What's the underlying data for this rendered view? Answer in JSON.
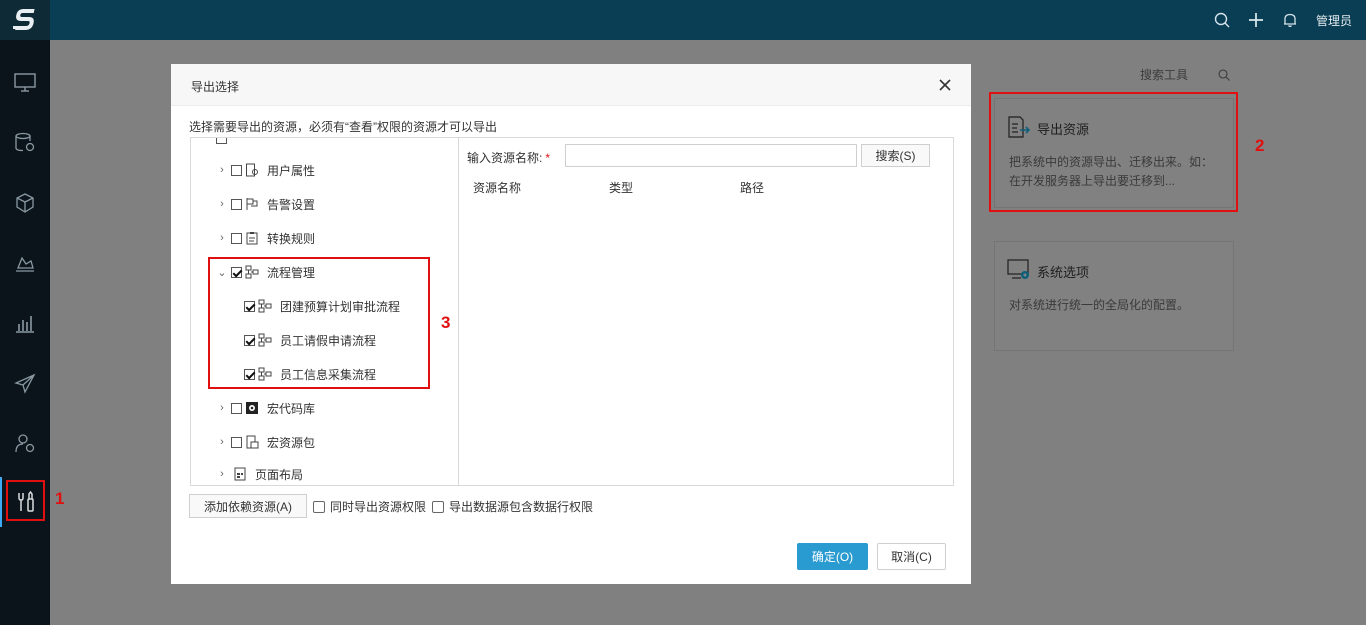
{
  "header": {
    "user_label": "管理员",
    "icons": [
      "search-icon",
      "plus-icon",
      "bell-icon"
    ]
  },
  "sidebar": {
    "icons": [
      "monitor-icon",
      "database-gear-icon",
      "cube-icon",
      "chart-area-icon",
      "bar-chart-icon",
      "send-icon",
      "user-settings-icon",
      "tools-icon"
    ]
  },
  "background": {
    "search_tool_label": "搜索工具",
    "cards": [
      {
        "title": "导出资源",
        "desc": "把系统中的资源导出、迁移出来。如：在开发服务器上导出要迁移到..."
      },
      {
        "title": "系统选项",
        "desc": "对系统进行统一的全局化的配置。"
      }
    ]
  },
  "annotations": {
    "n1": "1",
    "n2": "2",
    "n3": "3"
  },
  "dialog": {
    "title": "导出选择",
    "hint": "选择需要导出的资源，必须有“查看”权限的资源才可以导出",
    "tree": {
      "items": [
        {
          "label": "用户属性",
          "checked": false
        },
        {
          "label": "告警设置",
          "checked": false
        },
        {
          "label": "转换规则",
          "checked": false
        },
        {
          "label": "流程管理",
          "checked": true
        },
        {
          "label": "团建预算计划审批流程",
          "checked": true
        },
        {
          "label": "员工请假申请流程",
          "checked": true
        },
        {
          "label": "员工信息采集流程",
          "checked": true
        },
        {
          "label": "宏代码库",
          "checked": false
        },
        {
          "label": "宏资源包",
          "checked": false
        },
        {
          "label": "页面布局",
          "checked": false
        }
      ]
    },
    "search": {
      "label": "输入资源名称:",
      "required_mark": "*",
      "input_value": "",
      "button_label": "搜索(S)"
    },
    "columns": [
      "资源名称",
      "类型",
      "路径"
    ],
    "footer": {
      "add_dependency": "添加依赖资源(A)",
      "opt_export_perm": "同时导出资源权限",
      "opt_export_row_perm": "导出数据源包含数据行权限",
      "ok": "确定(O)",
      "cancel": "取消(C)"
    }
  },
  "colors": {
    "accent": "#2a9bd0",
    "annotation": "#e01010",
    "topbar": "#0a3e54"
  }
}
